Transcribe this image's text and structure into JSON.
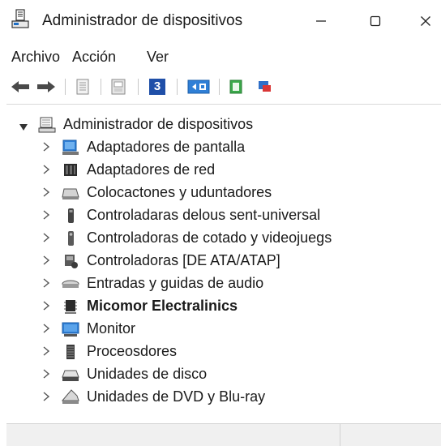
{
  "window": {
    "title": "Administrador de dispositivos",
    "controls": [
      "minimize-icon",
      "maximize-icon",
      "close-icon"
    ]
  },
  "menu": {
    "items": [
      {
        "label": "Archivo"
      },
      {
        "label": "Acción"
      },
      {
        "label": "Ver"
      }
    ]
  },
  "toolbar": {
    "buttons": [
      "back-arrow-icon",
      "forward-arrow-icon",
      "properties-icon",
      "driver-icon",
      "help-icon",
      "show-hidden-icon",
      "update-driver-icon",
      "uninstall-icon"
    ],
    "help_glyph": "3"
  },
  "tree": {
    "root": {
      "label": "Administrador de dispositivos",
      "icon": "computer-icon",
      "expanded": true
    },
    "items": [
      {
        "label": "Adaptadores de pantalla",
        "icon": "display-adapter-icon"
      },
      {
        "label": "Adaptadores de red",
        "icon": "network-adapter-icon"
      },
      {
        "label": "Colocactones y uduntadores",
        "icon": "keyboard-icon"
      },
      {
        "label": "Controladaras delous sent-universal",
        "icon": "usb-controller-icon"
      },
      {
        "label": "Controladoras de cotado y videojuegs",
        "icon": "game-controller-icon"
      },
      {
        "label": "Controladoras [DE ATA/ATAP]",
        "icon": "ide-controller-icon"
      },
      {
        "label": "Entradas y guidas de audio",
        "icon": "audio-icon"
      },
      {
        "label": "Micomor Electralinics",
        "icon": "chip-icon",
        "bold": true
      },
      {
        "label": "Monitor",
        "icon": "monitor-icon"
      },
      {
        "label": "Proceosdores",
        "icon": "processor-icon"
      },
      {
        "label": "Unidades de disco",
        "icon": "disk-drive-icon"
      },
      {
        "label": "Unidades de DVD y Blu-ray",
        "icon": "dvd-drive-icon"
      }
    ]
  },
  "colors": {
    "accent_blue": "#1f6fc5",
    "toolbar_green": "#3aa84a",
    "toolbar_red": "#d93636"
  }
}
